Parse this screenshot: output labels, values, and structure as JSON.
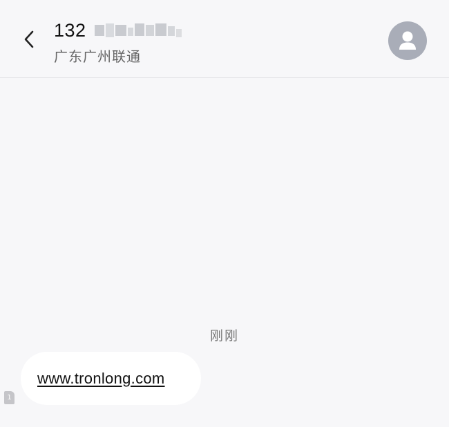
{
  "header": {
    "back_icon": "chevron-left-icon",
    "phone_prefix": "132",
    "carrier": "广东广州联通",
    "avatar_icon": "person-icon"
  },
  "conversation": {
    "timestamp": "刚刚",
    "messages": [
      {
        "text": "www.tronlong.com",
        "sim_badge": "1"
      }
    ]
  },
  "colors": {
    "background": "#f7f7f9",
    "bubble": "#ffffff",
    "avatar": "#a9adb8"
  }
}
